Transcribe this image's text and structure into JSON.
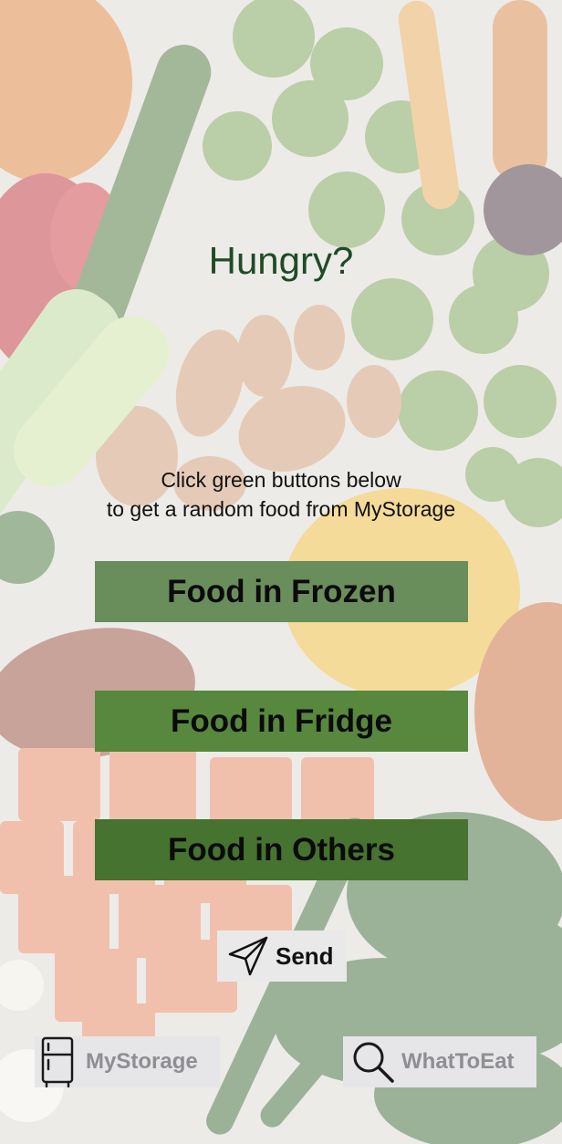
{
  "screen": {
    "title": "Hungry?",
    "instructions": {
      "line1": "Click green buttons below",
      "line2": "to get a random food from MyStorage"
    }
  },
  "buttons": {
    "frozen": "Food in Frozen",
    "fridge": "Food in Fridge",
    "others": "Food in Others"
  },
  "send": {
    "label": "Send",
    "icon": "paper-plane-icon"
  },
  "tab_bar": {
    "items": [
      {
        "label": "MyStorage",
        "icon": "refrigerator-icon"
      },
      {
        "label": "WhatToEat",
        "icon": "magnifier-icon"
      }
    ]
  },
  "colors": {
    "title": "#1f4b26",
    "frozen_button": "#6a8e5b",
    "fridge_button": "#57883e",
    "others_button": "#46732f",
    "tab_label": "#8e8e93"
  }
}
